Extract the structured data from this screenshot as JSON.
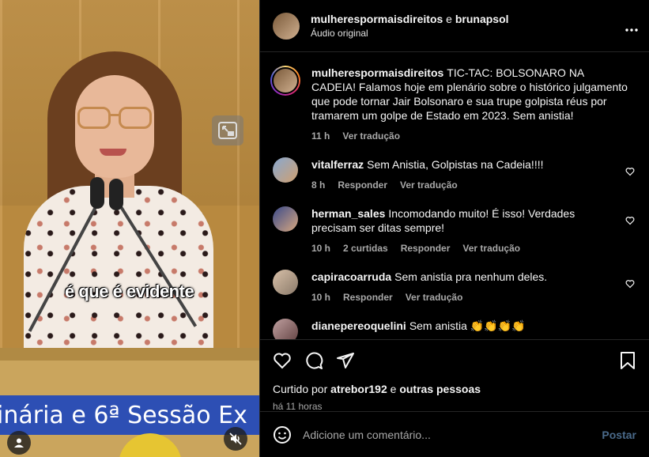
{
  "video": {
    "caption": "é que é evidente",
    "banner_text": "inária e 6ª Sessão Ex"
  },
  "header": {
    "account_1": "mulherespormaisdireitos",
    "connector": "e",
    "account_2": "brunapsol",
    "audio": "Áudio original"
  },
  "post": {
    "username": "mulherespormaisdireitos",
    "text": "TIC-TAC: BOLSONARO NA CADEIA! Falamos hoje em plenário sobre o histórico julgamento que pode tornar Jair Bolsonaro e sua trupe golpista réus por tramarem um golpe de Estado em 2023. Sem anistia!",
    "time": "11 h",
    "translate": "Ver tradução"
  },
  "comments": [
    {
      "username": "vitalferraz",
      "text": "Sem Anistia, Golpistas na Cadeia!!!!",
      "time": "8 h",
      "likes": "",
      "reply": "Responder",
      "translate": "Ver tradução"
    },
    {
      "username": "herman_sales",
      "text": "Incomodando muito! É isso! Verdades precisam ser ditas sempre!",
      "time": "10 h",
      "likes": "2 curtidas",
      "reply": "Responder",
      "translate": "Ver tradução"
    },
    {
      "username": "capiracoarruda",
      "text": "Sem anistia pra nenhum deles.",
      "time": "10 h",
      "likes": "",
      "reply": "Responder",
      "translate": "Ver tradução"
    },
    {
      "username": "dianepereoquelini",
      "text": "Sem anistia 👏👏👏👏",
      "time": "",
      "likes": "",
      "reply": "",
      "translate": ""
    }
  ],
  "likes": {
    "prefix": "Curtido por",
    "user": "atrebor192",
    "connector": "e",
    "others": "outras pessoas"
  },
  "posted_ago": "há 11 horas",
  "add_comment": {
    "placeholder": "Adicione um comentário...",
    "post_label": "Postar"
  },
  "icons": [
    "more-icon",
    "heart-icon",
    "comment-icon",
    "share-icon",
    "save-icon",
    "emoji-icon",
    "expand-icon",
    "profile-icon",
    "mute-icon"
  ]
}
